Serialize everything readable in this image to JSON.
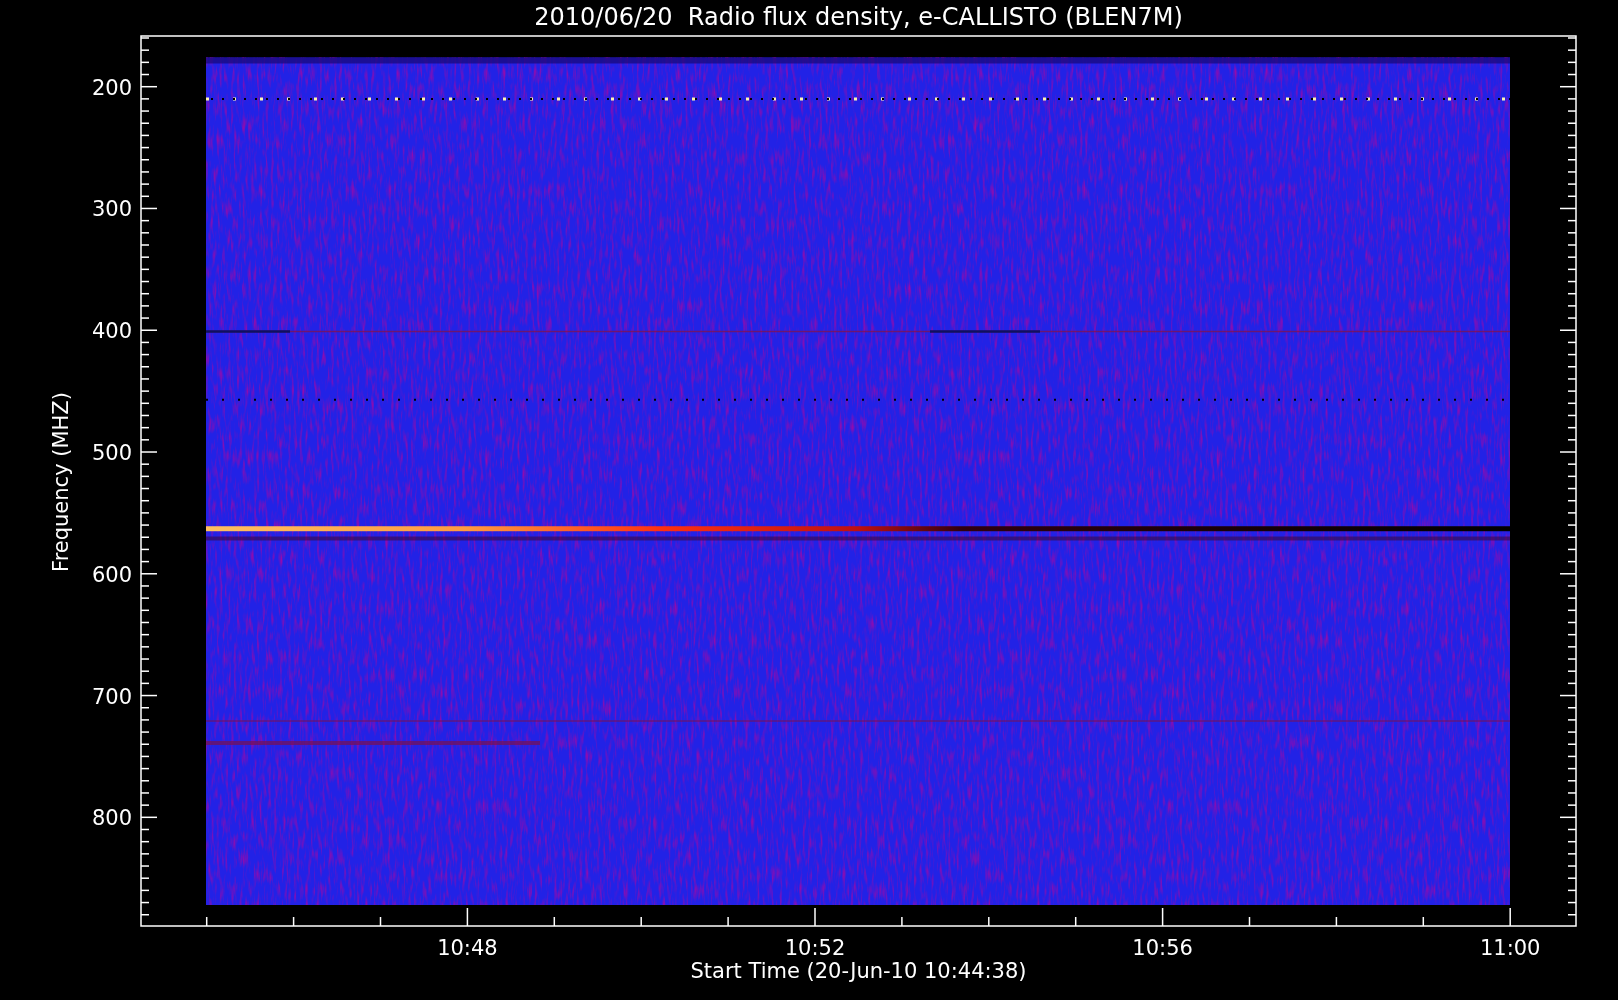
{
  "title": "2010/06/20  Radio flux density, e-CALLISTO (BLEN7M)",
  "y_axis": {
    "label": "Frequency (MHZ)",
    "ticks": [
      "200",
      "300",
      "400",
      "500",
      "600",
      "700",
      "800"
    ]
  },
  "x_axis": {
    "label": "Start Time (20-Jun-10 10:44:38)",
    "ticks": [
      "10:48",
      "10:52",
      "10:56",
      "11:00"
    ]
  }
}
